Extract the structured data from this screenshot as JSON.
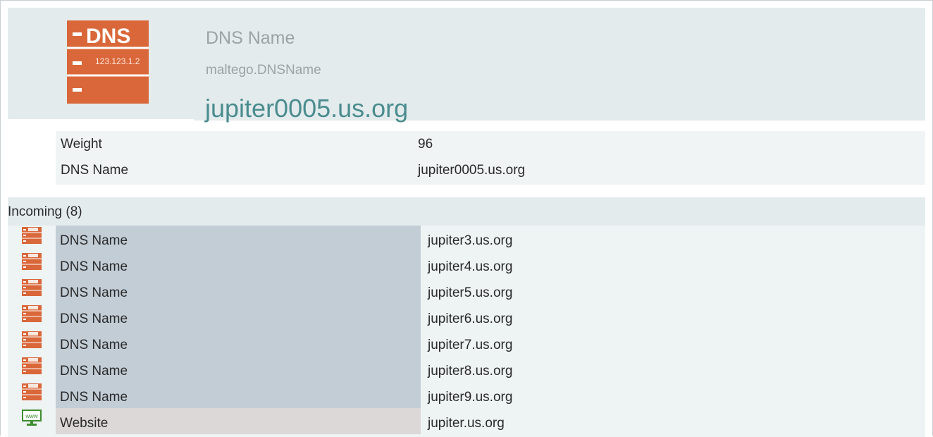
{
  "entity": {
    "type_name": "DNS Name",
    "type_id": "maltego.DNSName",
    "value": "jupiter0005.us.org",
    "icon": "dns-server-icon",
    "icon_label": "DNS",
    "icon_ip": "123.123.1.2"
  },
  "properties": [
    {
      "key": "Weight",
      "value": "96"
    },
    {
      "key": "DNS Name",
      "value": "jupiter0005.us.org"
    }
  ],
  "incoming": {
    "title": "Incoming (8)",
    "rows": [
      {
        "type": "DNS Name",
        "value": "jupiter3.us.org",
        "icon": "dns-server-icon"
      },
      {
        "type": "DNS Name",
        "value": "jupiter4.us.org",
        "icon": "dns-server-icon"
      },
      {
        "type": "DNS Name",
        "value": "jupiter5.us.org",
        "icon": "dns-server-icon"
      },
      {
        "type": "DNS Name",
        "value": "jupiter6.us.org",
        "icon": "dns-server-icon"
      },
      {
        "type": "DNS Name",
        "value": "jupiter7.us.org",
        "icon": "dns-server-icon"
      },
      {
        "type": "DNS Name",
        "value": "jupiter8.us.org",
        "icon": "dns-server-icon"
      },
      {
        "type": "DNS Name",
        "value": "jupiter9.us.org",
        "icon": "dns-server-icon"
      },
      {
        "type": "Website",
        "value": "jupiter.us.org",
        "icon": "website-monitor-icon",
        "icon_label": "www"
      }
    ]
  },
  "colors": {
    "dns_orange": "#d9673a",
    "accent_teal": "#4b8c8e",
    "header_bg": "#e3ebed",
    "website_green": "#3e8e2f"
  }
}
